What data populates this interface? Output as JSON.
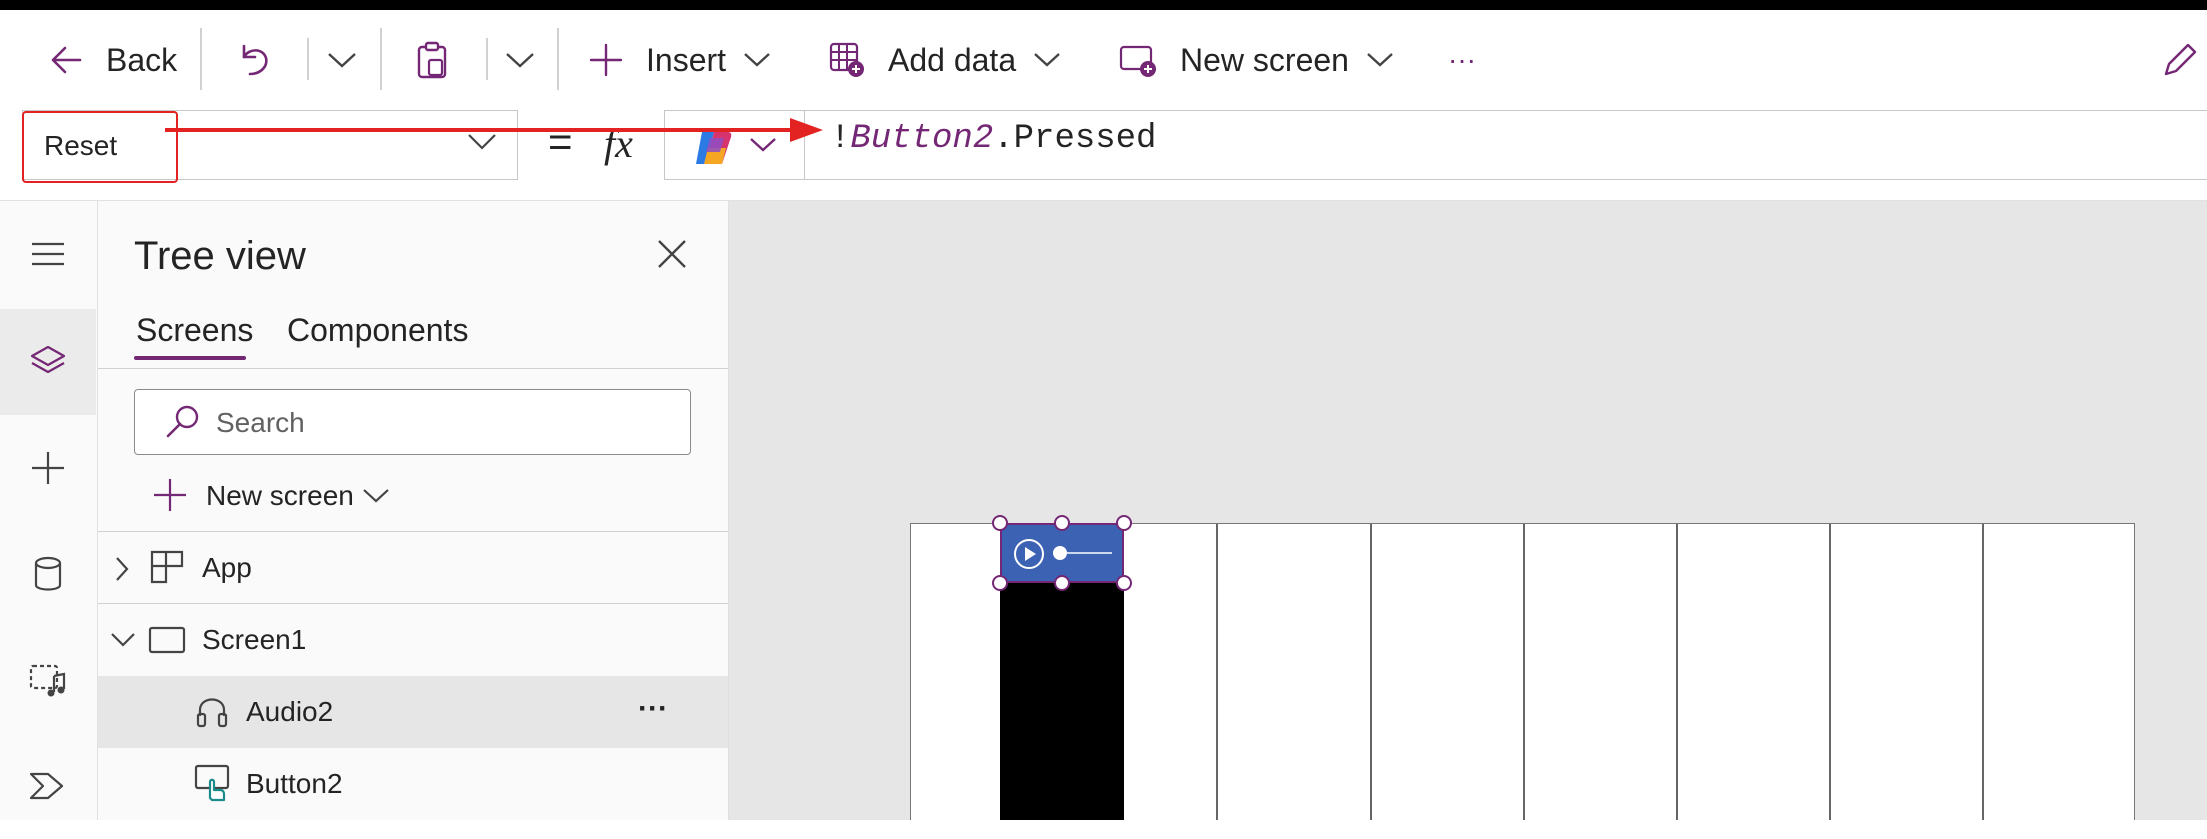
{
  "command_bar": {
    "back_label": "Back",
    "insert_label": "Insert",
    "add_data_label": "Add data",
    "new_screen_label": "New screen",
    "more_label": "···"
  },
  "formula_bar": {
    "property": "Reset",
    "equals": "=",
    "fx": "fx",
    "formula_prefix": "!",
    "formula_control": "Button2",
    "formula_suffix": ".Pressed"
  },
  "tree_view": {
    "title": "Tree view",
    "tabs": [
      {
        "label": "Screens",
        "selected": true
      },
      {
        "label": "Components",
        "selected": false
      }
    ],
    "search_placeholder": "Search",
    "new_screen_label": "New screen",
    "items": [
      {
        "label": "App",
        "icon": "app-icon",
        "expanded": false
      },
      {
        "label": "Screen1",
        "icon": "screen-icon",
        "expanded": true
      },
      {
        "label": "Audio2",
        "icon": "headphones-icon",
        "selected": true
      },
      {
        "label": "Button2",
        "icon": "button-icon",
        "selected": false
      }
    ],
    "row_more_label": "···"
  },
  "colors": {
    "accent": "#742774",
    "annotation_arrow": "#e32222",
    "audio_control": "#3c62b4",
    "canvas": "#e6e6e6"
  }
}
